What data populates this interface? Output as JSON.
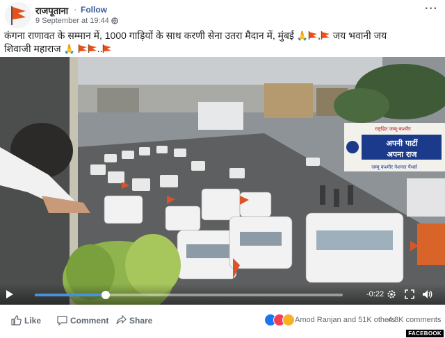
{
  "post": {
    "page_name": "राजपूताना",
    "separator": "·",
    "follow_label": "Follow",
    "timestamp": "9 September at 19:44 ·",
    "more_label": "···",
    "caption_line1": "कंगना राणावत के सम्मान में, 1000 गाड़ियों के साथ करणी सेना उतरा मैदान में, मुंबई",
    "caption_line1_tail": "जय भवानी जय",
    "caption_line2": "शिवाजी महाराज",
    "caption_sep1": ",",
    "caption_ellipsis": ".."
  },
  "video": {
    "banner_main": "अपनी पार्टी",
    "banner_sub": "अपना राज",
    "banner_bottom": "जम्मू कश्मीर नेशनल पैंथर्स",
    "banner_top": "राष्ट्रहित  जम्मू-कश्मीर",
    "time_remaining": "-0:22",
    "progress": 0.23
  },
  "actions": {
    "like": "Like",
    "comment": "Comment",
    "share": "Share",
    "reactors": "Amod Ranjan and 51K others",
    "comments_count": "4.8K comments"
  },
  "watermark": "FACEBOOK",
  "colors": {
    "link_blue": "#385898",
    "flag_saffron": "#e8501a",
    "progress_blue": "#4a90e2"
  }
}
